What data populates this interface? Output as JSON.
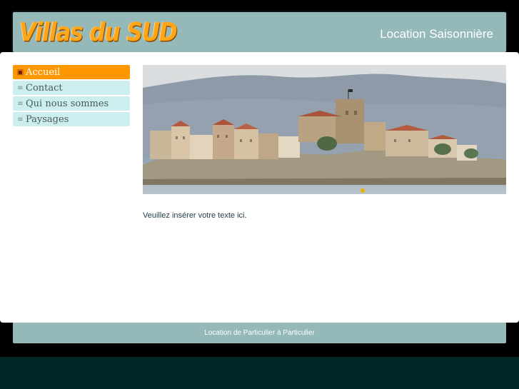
{
  "site": {
    "logo_text": "Villas du SUD",
    "tagline": "Location Saisonnière"
  },
  "nav": {
    "items": [
      {
        "label": "Accueil",
        "icon": "home-icon",
        "active": true
      },
      {
        "label": "Contact",
        "icon": "list-icon",
        "active": false
      },
      {
        "label": "Qui nous sommes",
        "icon": "list-icon",
        "active": false
      },
      {
        "label": "Paysages",
        "icon": "list-icon",
        "active": false
      }
    ]
  },
  "main": {
    "body_text": "Veuillez insérer votre texte ici."
  },
  "footer": {
    "text": "Location de Particulier à Particulier"
  },
  "colors": {
    "header_bg": "#94b9b8",
    "accent": "#ff9800",
    "nav_bg": "#cdeeee",
    "logo": "#ffa51a"
  }
}
